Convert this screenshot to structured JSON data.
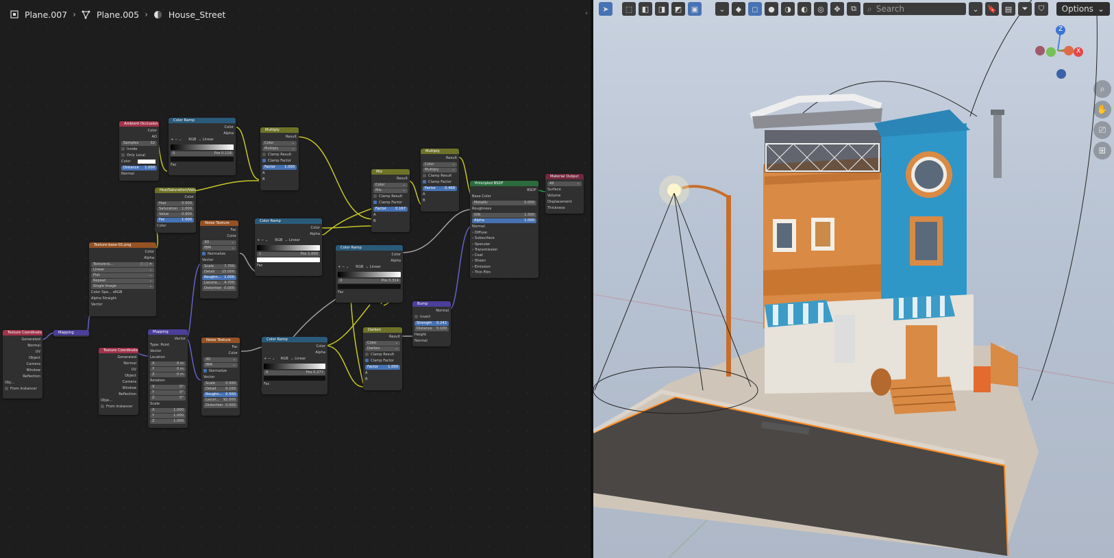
{
  "breadcrumb": {
    "items": [
      {
        "label": "Plane.007",
        "icon": "object-icon"
      },
      {
        "label": "Plane.005",
        "icon": "mesh-data-icon"
      },
      {
        "label": "House_Street",
        "icon": "material-icon"
      }
    ]
  },
  "viewport": {
    "search_placeholder": "Search",
    "options_label": "Options",
    "gizmo": {
      "z": "Z",
      "x": "X"
    }
  },
  "nodes": {
    "ao": {
      "title": "Ambient Occlusion",
      "out_color": "Color",
      "out_ao": "AO",
      "samples_label": "Samples",
      "samples": "32",
      "inside": "Inside",
      "only_local": "Only Local",
      "color": "Color",
      "distance_label": "Distance",
      "distance": "1.000",
      "normal": "Normal"
    },
    "ramp1": {
      "title": "Color Ramp",
      "out_color": "Color",
      "out_alpha": "Alpha",
      "mode": "RGB",
      "interp": "Linear",
      "idx": "0",
      "pos_label": "Pos",
      "pos": "0.118",
      "fac": "Fac"
    },
    "multiply1": {
      "title": "Multiply",
      "result": "Result",
      "type": "Color",
      "blend": "Multiply",
      "clamp_result": "Clamp Result",
      "clamp_factor": "Clamp Factor",
      "factor_label": "Factor",
      "factor": "1.000",
      "a": "A",
      "b": "B"
    },
    "hsv": {
      "title": "Hue/Saturation/Value",
      "out": "Color",
      "hue_label": "Hue",
      "hue": "0.500",
      "sat_label": "Saturation",
      "sat": "1.000",
      "val_label": "Value",
      "val": "0.800",
      "fac_label": "Fac",
      "fac": "1.000",
      "color": "Color"
    },
    "image": {
      "title": "Texture-base-01.png",
      "out_color": "Color",
      "out_alpha": "Alpha",
      "file": "Texture-b...",
      "interp": "Linear",
      "proj": "Flat",
      "ext": "Repeat",
      "src": "Single Image",
      "cs_label": "Color Spa...",
      "cs": "sRGB",
      "alpha_label": "Alpha",
      "alpha": "Straight",
      "vector": "Vector"
    },
    "noise1": {
      "title": "Noise Texture",
      "fac": "Fac",
      "color": "Color",
      "dim": "3D",
      "type": "fBM",
      "normalize": "Normalize",
      "vector": "Vector",
      "scale_label": "Scale",
      "scale": "7.700",
      "detail_label": "Detail",
      "detail": "15.000",
      "rough_label": "Roughn...",
      "rough": "1.000",
      "lac_label": "Lacuna...",
      "lac": "4.700",
      "dist_label": "Distortion",
      "dist": "0.000"
    },
    "ramp2": {
      "title": "Color Ramp",
      "out_color": "Color",
      "out_alpha": "Alpha",
      "mode": "RGB",
      "interp": "Linear",
      "idx": "1",
      "pos_label": "Pos",
      "pos": "1.000",
      "fac": "Fac"
    },
    "mix": {
      "title": "Mix",
      "result": "Result",
      "type": "Color",
      "blend": "Mix",
      "clamp_result": "Clamp Result",
      "clamp_factor": "Clamp Factor",
      "factor_label": "Factor",
      "factor": "0.167",
      "a": "A",
      "b": "B"
    },
    "ramp3": {
      "title": "Color Ramp",
      "out_color": "Color",
      "out_alpha": "Alpha",
      "mode": "RGB",
      "interp": "Linear",
      "idx": "0",
      "pos_label": "Pos",
      "pos": "0.314",
      "fac": "Fac"
    },
    "multiply2": {
      "title": "Multiply",
      "result": "Result",
      "type": "Color",
      "blend": "Multiply",
      "clamp_result": "Clamp Result",
      "clamp_factor": "Clamp Factor",
      "factor_label": "Factor",
      "factor": "0.468",
      "a": "A",
      "b": "B"
    },
    "bsdf": {
      "title": "Principled BSDF",
      "out": "BSDF",
      "base_color": "Base Color",
      "metallic_label": "Metallic",
      "metallic": "0.000",
      "roughness": "Roughness",
      "ior_label": "IOR",
      "ior": "1.500",
      "alpha_label": "Alpha",
      "alpha": "1.000",
      "normal": "Normal",
      "panels": [
        "Diffuse",
        "Subsurface",
        "Specular",
        "Transmission",
        "Coat",
        "Sheen",
        "Emission",
        "Thin Film"
      ]
    },
    "output": {
      "title": "Material Output",
      "target": "All",
      "surface": "Surface",
      "volume": "Volume",
      "displacement": "Displacement",
      "thickness": "Thickness"
    },
    "texcoord1": {
      "title": "Texture Coordinate",
      "outs": [
        "Generated",
        "Normal",
        "UV",
        "Object",
        "Camera",
        "Window",
        "Reflection"
      ],
      "obj": "Obj...",
      "from_instancer": "From Instancer"
    },
    "mapping1": {
      "title": "Mapping"
    },
    "texcoord2": {
      "title": "Texture Coordinate",
      "outs": [
        "Generated",
        "Normal",
        "UV",
        "Object",
        "Camera",
        "Window",
        "Reflection"
      ],
      "obj": "Obje...",
      "from_instancer": "From Instancer"
    },
    "mapping2": {
      "title": "Mapping",
      "out": "Vector",
      "type_label": "Type:",
      "type": "Point",
      "vector": "Vector",
      "location": "Location",
      "lx": "0 m",
      "ly": "0 m",
      "lz": "0 m",
      "rotation": "Rotation",
      "rx": "0°",
      "ry": "0°",
      "rz": "0°",
      "scale": "Scale",
      "sx": "1.000",
      "sy": "1.000",
      "sz": "1.000"
    },
    "noise2": {
      "title": "Noise Texture",
      "fac": "Fac",
      "color": "Color",
      "dim": "3D",
      "type": "fBM",
      "normalize": "Normalize",
      "vector": "Vector",
      "scale_label": "Scale",
      "scale": "0.500",
      "detail_label": "Detail",
      "detail": "0.100",
      "rough_label": "Roughn...",
      "rough": "0.500",
      "lac_label": "Lacun...",
      "lac": "92.000",
      "dist_label": "Distortion",
      "dist": "0.000"
    },
    "ramp4": {
      "title": "Color Ramp",
      "out_color": "Color",
      "out_alpha": "Alpha",
      "mode": "RGB",
      "interp": "Linear",
      "idx": "0",
      "pos_label": "Pos",
      "pos": "0.277",
      "fac": "Fac"
    },
    "darken": {
      "title": "Darken",
      "result": "Result",
      "type": "Color",
      "blend": "Darken",
      "clamp_result": "Clamp Result",
      "clamp_factor": "Clamp Factor",
      "factor_label": "Factor",
      "factor": "1.000",
      "a": "A",
      "b": "B"
    },
    "bump": {
      "title": "Bump",
      "out": "Normal",
      "invert": "Invert",
      "strength_label": "Strength",
      "strength": "0.242",
      "distance_label": "Distance",
      "distance": "0.100",
      "height": "Height",
      "normal": "Normal"
    }
  },
  "colors": {
    "accent": "#4772b3",
    "selection_outline": "#ff8a1f",
    "wire_yellow": "#c7c729",
    "wire_purple": "#6363c7",
    "wire_gray": "#a1a1a1"
  }
}
